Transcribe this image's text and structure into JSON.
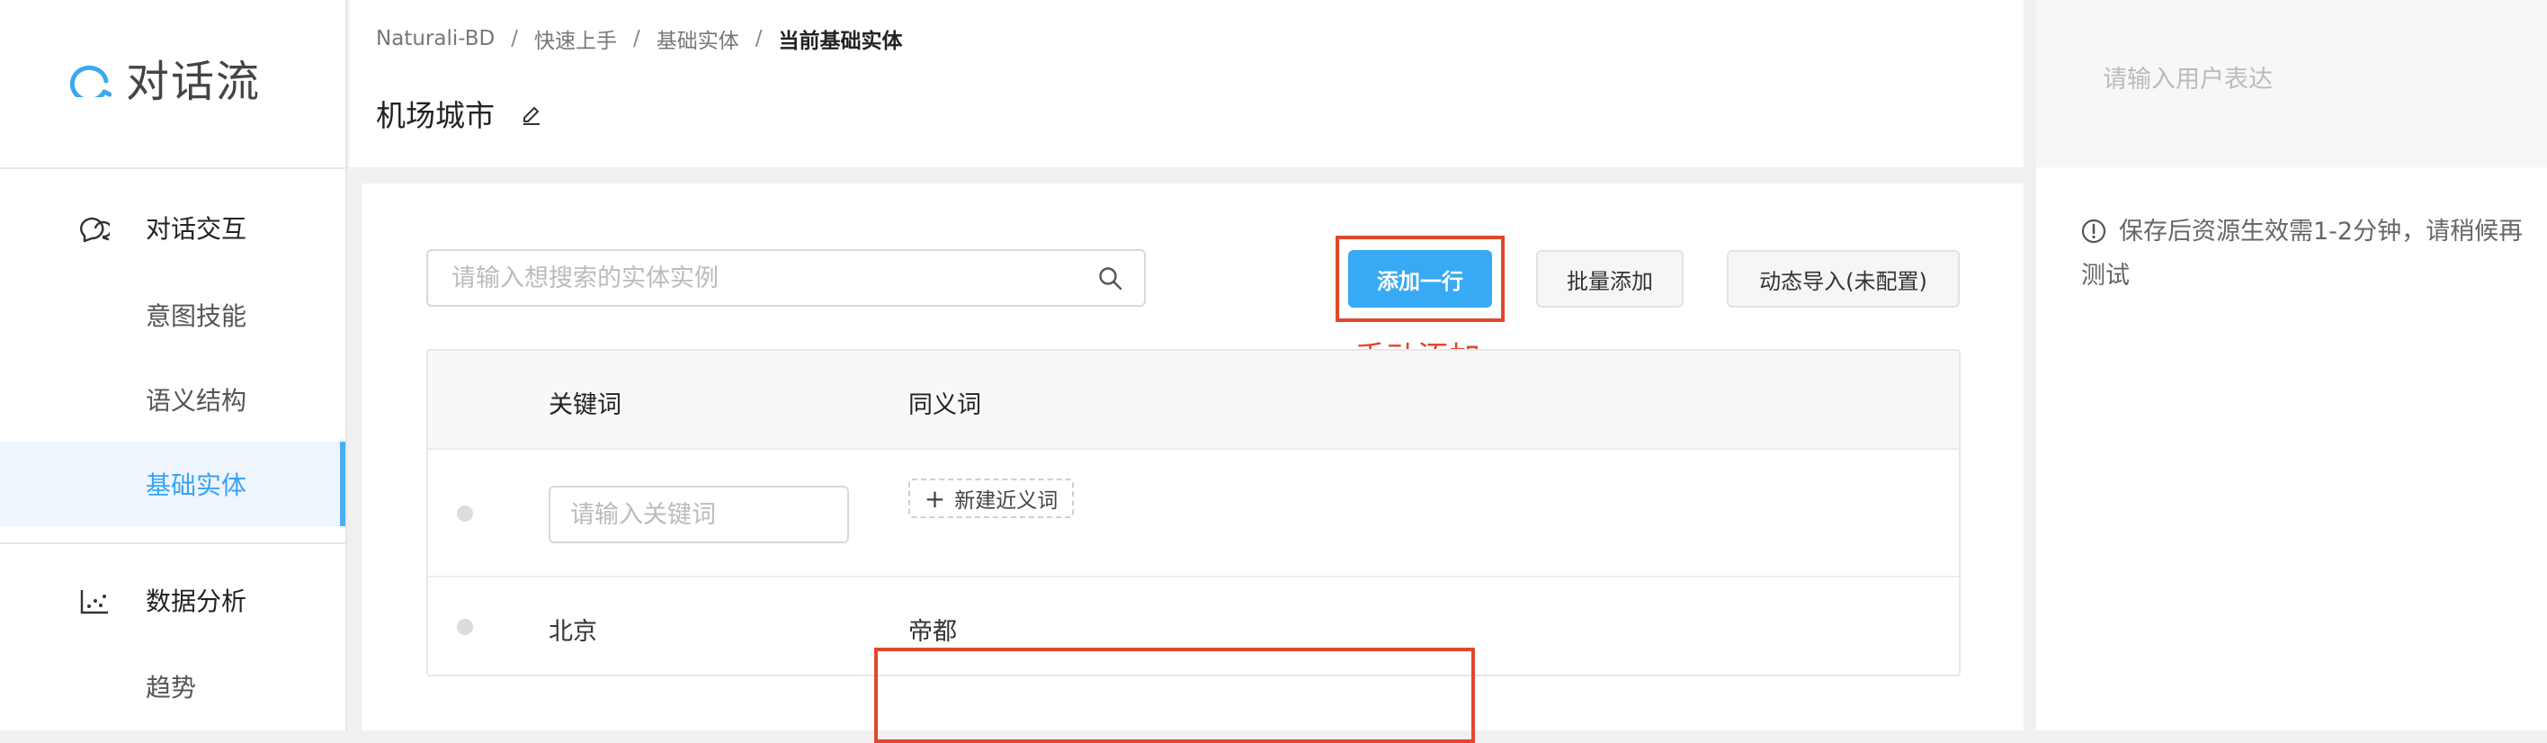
{
  "app": {
    "name": "对话流",
    "brand_color": "#36a3f7"
  },
  "sidebar": {
    "sections": [
      {
        "label": "对话交互",
        "icon": "chat-bubble-icon"
      },
      {
        "label": "数据分析",
        "icon": "scatter-chart-icon"
      }
    ],
    "items": [
      {
        "label": "意图技能"
      },
      {
        "label": "语义结构"
      },
      {
        "label": "基础实体",
        "active": true
      },
      {
        "label": "趋势"
      }
    ]
  },
  "breadcrumb": [
    "Naturali-BD",
    "快速上手",
    "基础实体",
    "当前基础实体"
  ],
  "page": {
    "title": "机场城市"
  },
  "toolbar": {
    "search_placeholder": "请输入想搜索的实体实例",
    "add_row": "添加一行",
    "batch_add": "批量添加",
    "dynamic_import": "动态导入(未配置)"
  },
  "annotation": {
    "text": "手动添加",
    "color": "#e2472b"
  },
  "table": {
    "headers": {
      "keyword": "关键词",
      "synonyms": "同义词"
    },
    "new_row": {
      "keyword_placeholder": "请输入关键词",
      "add_synonym": "新建近义词"
    },
    "rows": [
      {
        "keyword": "北京",
        "synonyms": "帝都"
      }
    ]
  },
  "right_panel": {
    "input_placeholder": "请输入用户表达",
    "notice": "保存后资源生效需1-2分钟，请稍候再测试"
  }
}
